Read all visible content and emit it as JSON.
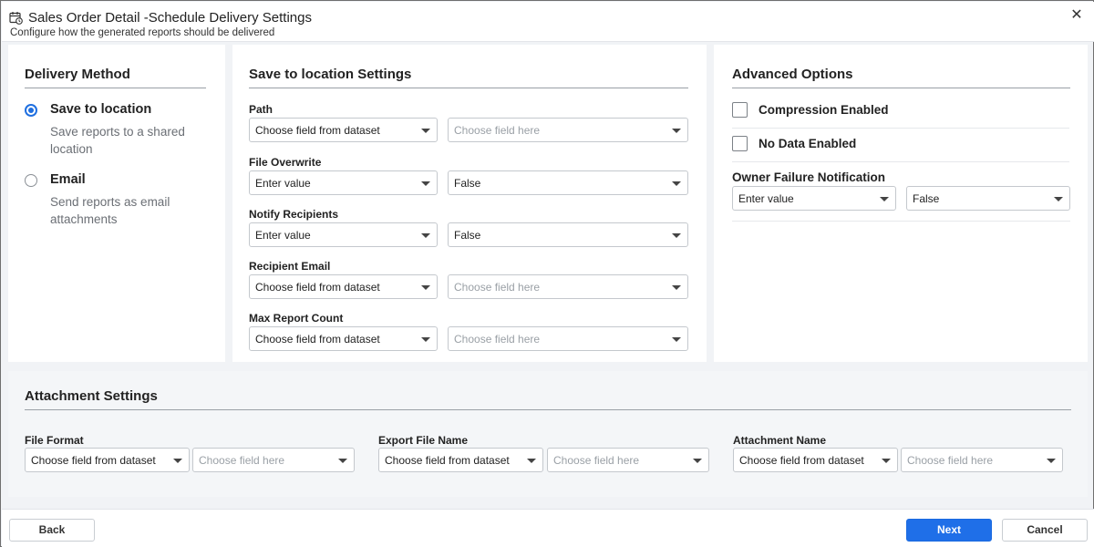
{
  "header": {
    "title": "Sales Order Detail -Schedule Delivery Settings",
    "subtitle": "Configure how the generated reports should be delivered",
    "icon": "calendar-clock-icon",
    "close_icon": "close-icon"
  },
  "delivery_method": {
    "title": "Delivery Method",
    "options": [
      {
        "label": "Save to location",
        "description": "Save reports to a shared location",
        "selected": true
      },
      {
        "label": "Email",
        "description": "Send reports as email attachments",
        "selected": false
      }
    ]
  },
  "location_settings": {
    "title": "Save to location Settings",
    "fields": [
      {
        "label": "Path",
        "left_value": "Choose field from dataset",
        "right_value": "Choose field here",
        "right_is_placeholder": true
      },
      {
        "label": "File Overwrite",
        "left_value": "Enter value",
        "right_value": "False",
        "right_is_placeholder": false
      },
      {
        "label": "Notify Recipients",
        "left_value": "Enter value",
        "right_value": "False",
        "right_is_placeholder": false
      },
      {
        "label": "Recipient Email",
        "left_value": "Choose field from dataset",
        "right_value": "Choose field here",
        "right_is_placeholder": true
      },
      {
        "label": "Max Report Count",
        "left_value": "Choose field from dataset",
        "right_value": "Choose field here",
        "right_is_placeholder": true
      }
    ]
  },
  "advanced": {
    "title": "Advanced Options",
    "checkboxes": [
      {
        "label": "Compression Enabled",
        "checked": false
      },
      {
        "label": "No Data Enabled",
        "checked": false
      }
    ],
    "owner_failure": {
      "label": "Owner Failure Notification",
      "left_value": "Enter value",
      "right_value": "False"
    }
  },
  "attachment": {
    "title": "Attachment Settings",
    "fields": [
      {
        "label": "File Format",
        "left_value": "Choose field from dataset",
        "right_value": "Choose field here"
      },
      {
        "label": "Export File Name",
        "left_value": "Choose field from dataset",
        "right_value": "Choose field here"
      },
      {
        "label": "Attachment Name",
        "left_value": "Choose field from dataset",
        "right_value": "Choose field here"
      }
    ]
  },
  "footer": {
    "back_label": "Back",
    "next_label": "Next",
    "cancel_label": "Cancel"
  },
  "colors": {
    "accent": "#1f6fe8",
    "placeholder": "#9aa0a6",
    "panel_bg": "#ffffff",
    "page_bg": "#f1f3f6"
  }
}
